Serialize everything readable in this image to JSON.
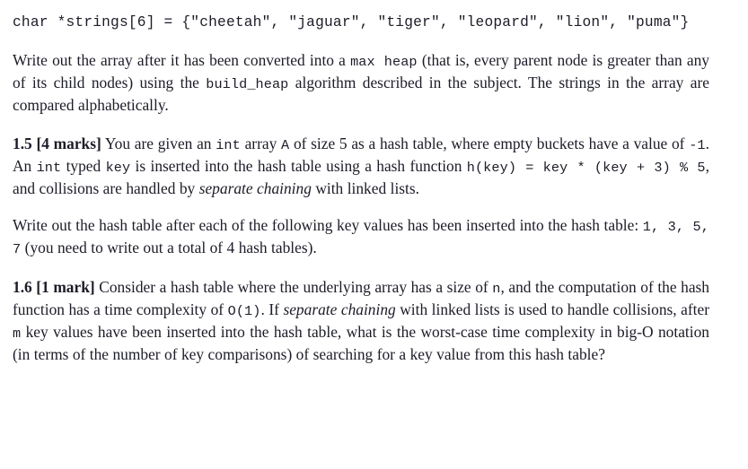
{
  "document": {
    "type": "assignment-question-page",
    "background_color": "#ffffff",
    "text_color": "#1c1c28",
    "blocks": [
      {
        "id": "code_declaration",
        "kind": "code",
        "text": "char *strings[6] = {\"cheetah\", \"jaguar\", \"tiger\", \"leopard\", \"lion\", \"puma\"}"
      },
      {
        "id": "paragraph_max_heap",
        "kind": "paragraph",
        "runs": [
          {
            "style": "normal",
            "text": "Write out the array after it has been converted into a "
          },
          {
            "style": "mono",
            "text": "max heap"
          },
          {
            "style": "normal",
            "text": " (that is, every parent node is greater than any of its child nodes) using the "
          },
          {
            "style": "mono",
            "text": "build_heap"
          },
          {
            "style": "normal",
            "text": " algorithm described in the subject. The strings in the array are compared alphabetically."
          }
        ]
      },
      {
        "id": "question_1_5",
        "kind": "paragraph",
        "runs": [
          {
            "style": "bold",
            "text": "1.5 [4 marks]"
          },
          {
            "style": "normal",
            "text": " You are given an "
          },
          {
            "style": "mono",
            "text": "int"
          },
          {
            "style": "normal",
            "text": " array "
          },
          {
            "style": "mono",
            "text": "A"
          },
          {
            "style": "normal",
            "text": " of size 5 as a hash table, where empty buckets have a value of "
          },
          {
            "style": "mono",
            "text": "-1"
          },
          {
            "style": "normal",
            "text": ". An "
          },
          {
            "style": "mono",
            "text": "int"
          },
          {
            "style": "normal",
            "text": " typed "
          },
          {
            "style": "mono",
            "text": "key"
          },
          {
            "style": "normal",
            "text": " is inserted into the hash table using a hash function "
          },
          {
            "style": "mono",
            "text": "h(key) = key * (key + 3) % 5"
          },
          {
            "style": "normal",
            "text": ", and collisions are handled by "
          },
          {
            "style": "italic",
            "text": "separate chaining"
          },
          {
            "style": "normal",
            "text": " with linked lists."
          }
        ]
      },
      {
        "id": "paragraph_write_hash_table",
        "kind": "paragraph",
        "runs": [
          {
            "style": "normal",
            "text": "Write out the hash table after each of the following key values has been inserted into the hash table: "
          },
          {
            "style": "mono",
            "text": "1, 3, 5, 7"
          },
          {
            "style": "normal",
            "text": " (you need to write out a total of 4 hash tables)."
          }
        ]
      },
      {
        "id": "question_1_6",
        "kind": "paragraph",
        "runs": [
          {
            "style": "bold",
            "text": "1.6 [1 mark]"
          },
          {
            "style": "normal",
            "text": " Consider a hash table where the underlying array has a size of "
          },
          {
            "style": "mono",
            "text": "n"
          },
          {
            "style": "normal",
            "text": ", and the computation of the hash function has a time complexity of "
          },
          {
            "style": "mono",
            "text": "O(1)"
          },
          {
            "style": "normal",
            "text": ". If "
          },
          {
            "style": "italic",
            "text": "separate chaining"
          },
          {
            "style": "normal",
            "text": " with linked lists is used to handle collisions, after "
          },
          {
            "style": "mono",
            "text": "m"
          },
          {
            "style": "normal",
            "text": " key values have been inserted into the hash table, what is the worst-case time complexity in big-O notation (in terms of the number of key comparisons) of searching for a key value from this hash table?"
          }
        ]
      }
    ]
  }
}
